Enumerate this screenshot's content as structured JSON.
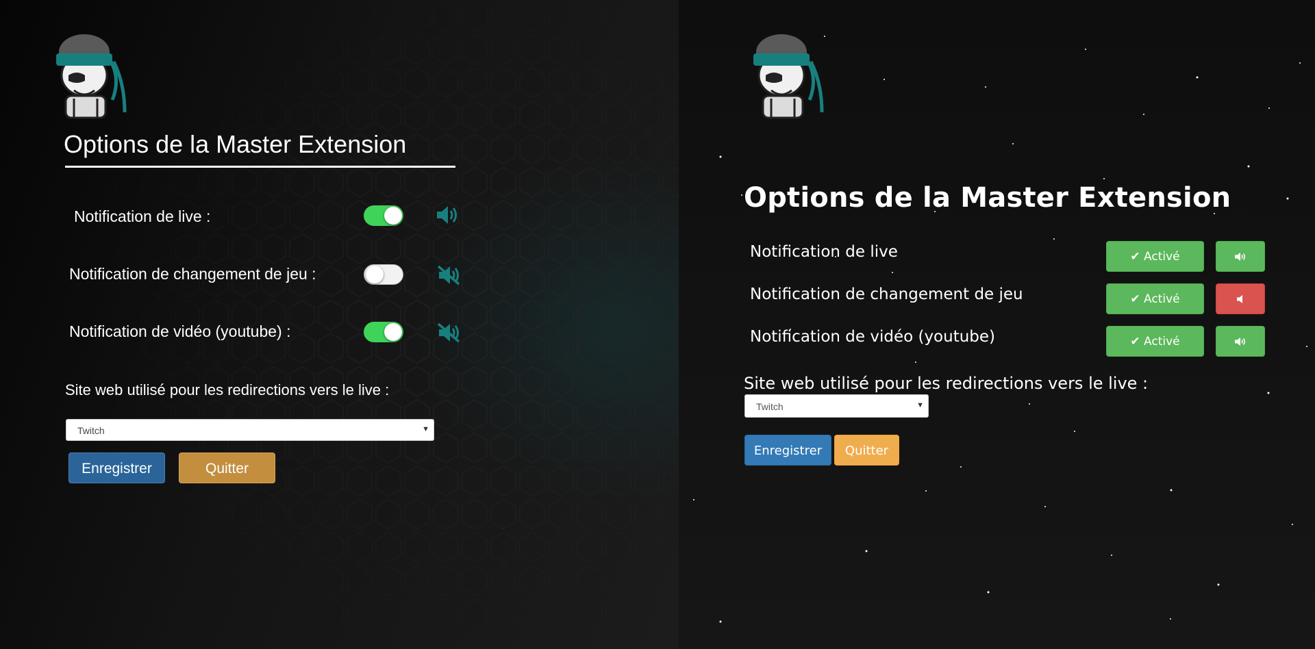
{
  "left": {
    "title": "Options de la Master Extension",
    "rows": [
      {
        "label": "Notification de live :",
        "toggle_on": true,
        "sound_icon": "volume-up-icon"
      },
      {
        "label": "Notification de changement de jeu :",
        "toggle_on": false,
        "sound_icon": "volume-mute-icon"
      },
      {
        "label": "Notification de vidéo (youtube) :",
        "toggle_on": true,
        "sound_icon": "volume-mute-icon"
      }
    ],
    "redirect_label": "Site web utilisé pour les redirections vers le live :",
    "select_value": "Twitch",
    "save_label": "Enregistrer",
    "quit_label": "Quitter"
  },
  "right": {
    "title": "Options de la Master Extension",
    "rows": [
      {
        "label": "Notification de live",
        "active_label": "Activé",
        "sound_on": true
      },
      {
        "label": "Notification de changement de jeu",
        "active_label": "Activé",
        "sound_on": false
      },
      {
        "label": "Notification de vidéo (youtube)",
        "active_label": "Activé",
        "sound_on": true
      }
    ],
    "redirect_label": "Site web utilisé pour les redirections vers le live :",
    "select_value": "Twitch",
    "save_label": "Enregistrer",
    "quit_label": "Quitter"
  },
  "colors": {
    "teal_accent": "#17807f",
    "toggle_on": "#3fd35a",
    "bootstrap_success": "#5cb85c",
    "bootstrap_danger": "#d9534f",
    "bootstrap_primary": "#337ab7",
    "bootstrap_warning": "#f0ad4e"
  }
}
